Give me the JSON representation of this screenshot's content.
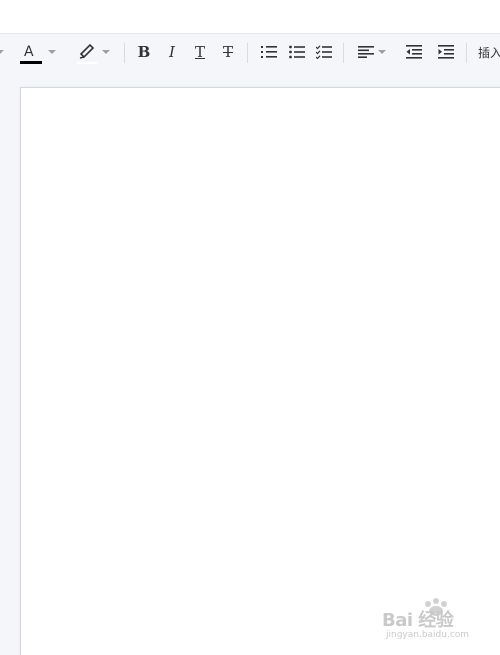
{
  "toolbar": {
    "font_color_glyph": "A",
    "font_color_swatch": "#000000",
    "bold_glyph": "B",
    "italic_glyph": "I",
    "underline_glyph": "T",
    "strike_glyph": "T",
    "insert_label": "插入"
  },
  "watermark": {
    "text": "Bai 经验",
    "sub": "jingyan.baidu.com"
  }
}
